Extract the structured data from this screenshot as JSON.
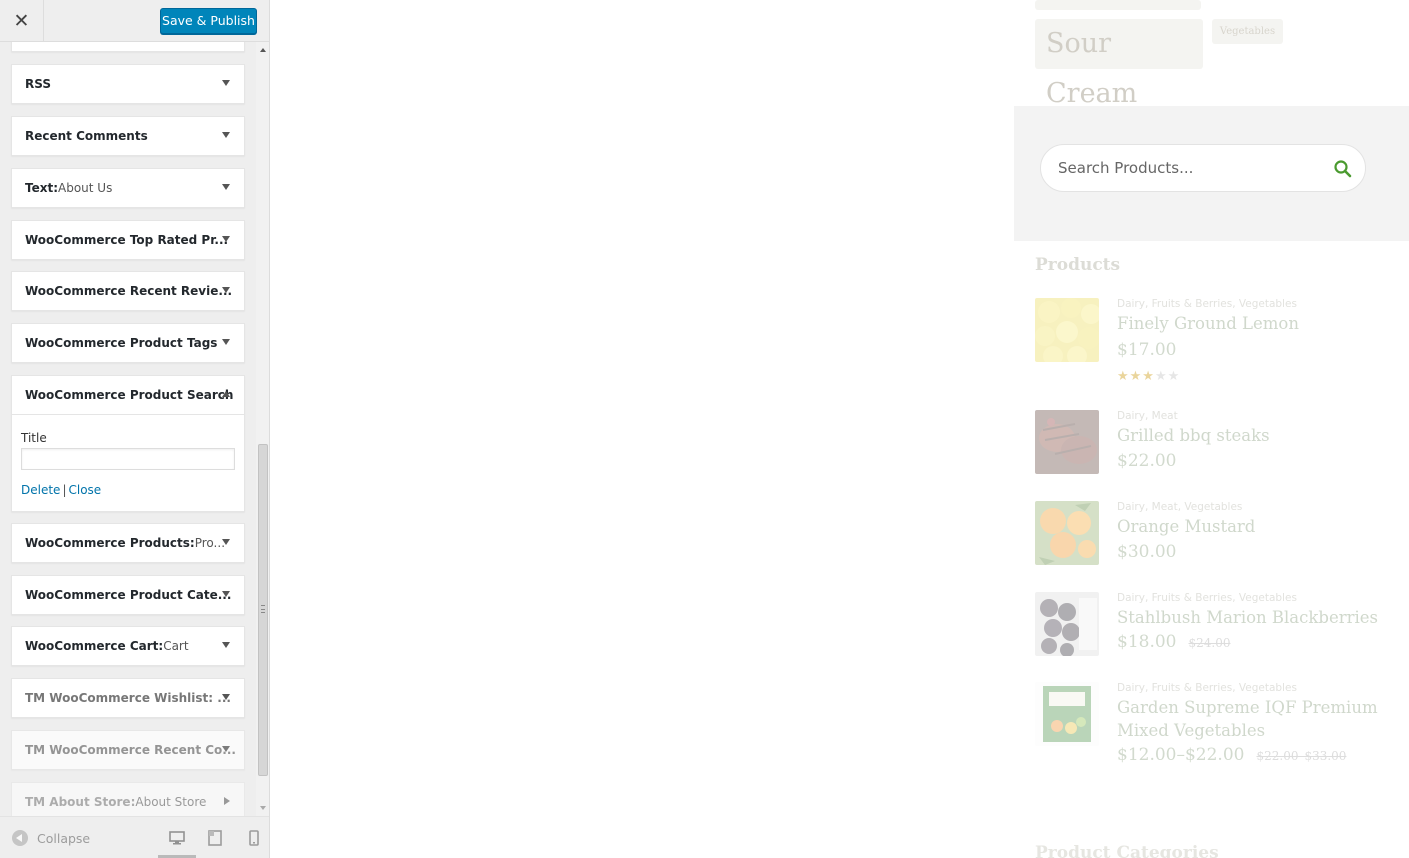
{
  "header": {
    "publish_label": "Save & Publish"
  },
  "widgets": [
    {
      "name": "",
      "title": ""
    },
    {
      "name": "RSS",
      "title": ""
    },
    {
      "name": "Recent Comments",
      "title": ""
    },
    {
      "name": "Text:",
      "title": " About Us"
    },
    {
      "name": "WooCommerce Top Rated Pr...",
      "title": ""
    },
    {
      "name": "WooCommerce Recent Revie...",
      "title": ""
    },
    {
      "name": "WooCommerce Product Tags",
      "title": ""
    },
    {
      "name": "WooCommerce Product Search",
      "title": ""
    },
    {
      "name": "WooCommerce Products:",
      "title": " Pro..."
    },
    {
      "name": "WooCommerce Product Cate...",
      "title": ""
    },
    {
      "name": "WooCommerce Cart:",
      "title": " Cart"
    },
    {
      "name": "TM WooCommerce Wishlist: ...",
      "title": ""
    },
    {
      "name": "TM WooCommerce Recent Co...",
      "title": ""
    },
    {
      "name": "TM About Store:",
      "title": " About Store"
    }
  ],
  "expanded_widget": {
    "title_label": "Title",
    "title_value": "",
    "delete_label": "Delete",
    "separator": "|",
    "close_label": "Close"
  },
  "footer": {
    "collapse_label": "Collapse"
  },
  "preview": {
    "tags": {
      "large": "Sour Cream",
      "small": "Vegetables"
    },
    "search": {
      "placeholder": "Search Products..."
    },
    "products_title": "Products",
    "products": [
      {
        "categories": "Dairy, Fruits & Berries, Vegetables",
        "name": "Finely Ground Lemon",
        "price": "$17.00",
        "old_price": "",
        "rating": 3
      },
      {
        "categories": "Dairy, Meat",
        "name": "Grilled bbq steaks",
        "price": "$22.00",
        "old_price": ""
      },
      {
        "categories": "Dairy, Meat, Vegetables",
        "name": "Orange Mustard",
        "price": "$30.00",
        "old_price": ""
      },
      {
        "categories": "Dairy, Fruits & Berries, Vegetables",
        "name": "Stahlbush Marion Blackberries",
        "price": "$18.00",
        "old_price": "$24.00"
      },
      {
        "categories": "Dairy, Fruits & Berries, Vegetables",
        "name_line1": "Garden Supreme IQF Premium",
        "name_line2": "Mixed Vegetables",
        "price": "$12.00–$22.00",
        "old_price": "$22.00–$33.00"
      }
    ],
    "categories_title": "Product Categories"
  },
  "colors": {
    "accent": "#0085ba",
    "link": "#0073aa",
    "search_icon": "#4a9a2f"
  },
  "icons": {
    "close": "close-icon",
    "collapse": "collapse-icon",
    "desktop": "desktop-icon",
    "tablet": "tablet-icon",
    "mobile": "mobile-icon",
    "search": "search-icon"
  }
}
